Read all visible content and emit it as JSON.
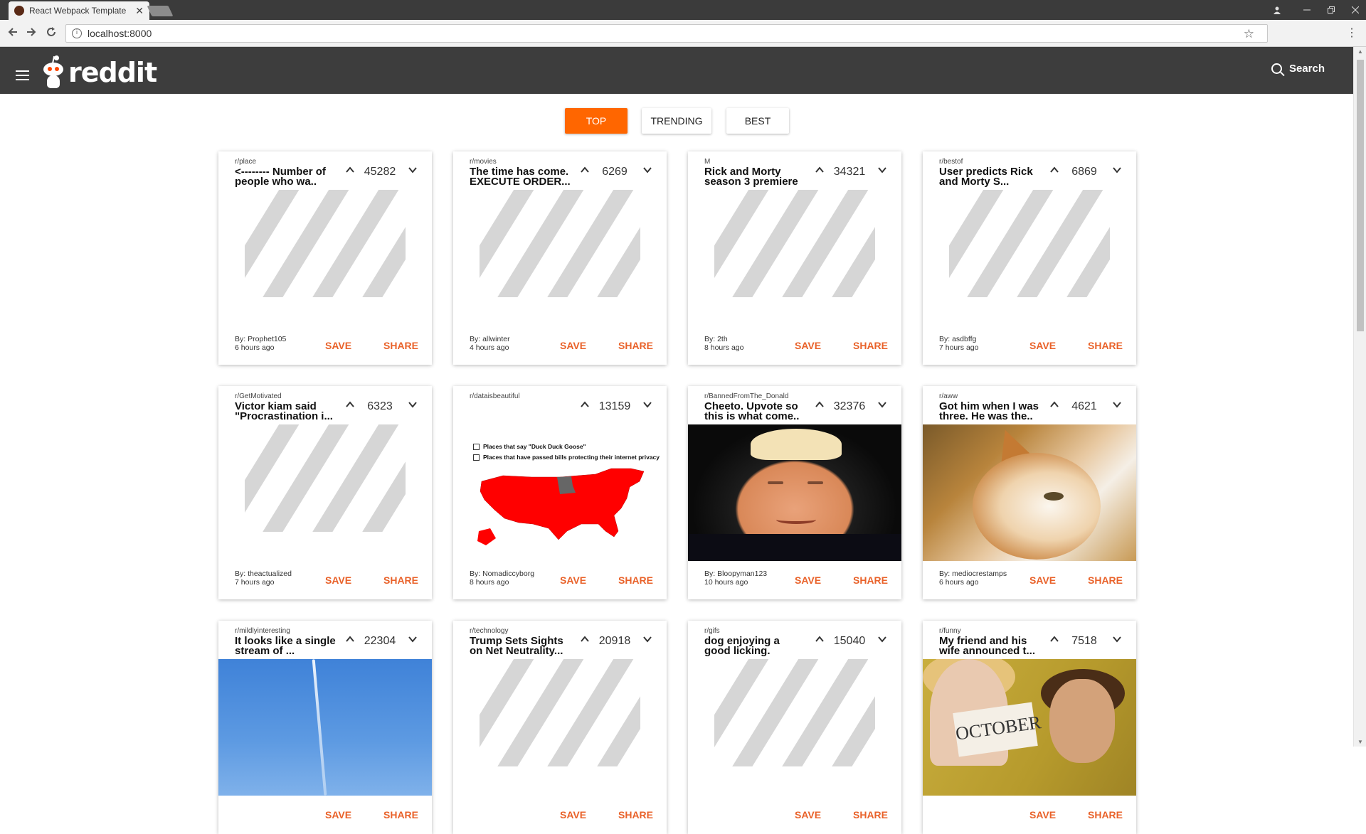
{
  "browser": {
    "tab_title": "React Webpack Template",
    "url": "localhost:8000"
  },
  "header": {
    "logo_text": "reddit",
    "search_label": "Search"
  },
  "filters": [
    "TOP",
    "TRENDING",
    "BEST"
  ],
  "actions": {
    "save": "SAVE",
    "share": "SHARE"
  },
  "map_legend": {
    "item1": "Places that say \"Duck Duck Goose\"",
    "item2": "Places that have passed bills protecting their internet privacy",
    "color_red": "#ff0000",
    "color_gray": "#666666"
  },
  "photo_text": {
    "sign": "OCTOBER"
  },
  "colors": {
    "accent": "#ff6600",
    "action": "#e9622a",
    "appbar": "#3d3d3d"
  },
  "posts": [
    {
      "subreddit": "r/place",
      "title": "<-------- Number of people who wa..",
      "score": "45282",
      "author": "By: Prophet105",
      "time": "6 hours ago",
      "media": "placeholder"
    },
    {
      "subreddit": "r/movies",
      "title": "The time has come. EXECUTE ORDER...",
      "score": "6269",
      "author": "By: allwinter",
      "time": "4 hours ago",
      "media": "placeholder"
    },
    {
      "subreddit": "M",
      "title": "Rick and Morty season 3 premiere",
      "score": "34321",
      "author": "By: 2th",
      "time": "8 hours ago",
      "media": "placeholder"
    },
    {
      "subreddit": "r/bestof",
      "title": "User predicts Rick and Morty S...",
      "score": "6869",
      "author": "By: asdbffg",
      "time": "7 hours ago",
      "media": "placeholder"
    },
    {
      "subreddit": "r/GetMotivated",
      "title": "Victor kiam said \"Procrastination i...",
      "score": "6323",
      "author": "By: theactualized",
      "time": "7 hours ago",
      "media": "placeholder"
    },
    {
      "subreddit": "r/dataisbeautiful",
      "title": "",
      "score": "13159",
      "author": "By: Nomadiccyborg",
      "time": "8 hours ago",
      "media": "map"
    },
    {
      "subreddit": "r/BannedFromThe_Donald",
      "title": "Cheeto. Upvote so this is what come..",
      "score": "32376",
      "author": "By: Bloopyman123",
      "time": "10 hours ago",
      "media": "trump"
    },
    {
      "subreddit": "r/aww",
      "title": "Got him when I was three. He was the..",
      "score": "4621",
      "author": "By: mediocrestamps",
      "time": "6 hours ago",
      "media": "cat"
    },
    {
      "subreddit": "r/mildlyinteresting",
      "title": "It looks like a single stream of ...",
      "score": "22304",
      "author": "",
      "time": "",
      "media": "sky"
    },
    {
      "subreddit": "r/technology",
      "title": "Trump Sets Sights on Net Neutrality...",
      "score": "20918",
      "author": "",
      "time": "",
      "media": "placeholder"
    },
    {
      "subreddit": "r/gifs",
      "title": "dog enjoying a good licking.",
      "score": "15040",
      "author": "",
      "time": "",
      "media": "placeholder"
    },
    {
      "subreddit": "r/funny",
      "title": "My friend and his wife announced t...",
      "score": "7518",
      "author": "",
      "time": "",
      "media": "couple"
    }
  ]
}
